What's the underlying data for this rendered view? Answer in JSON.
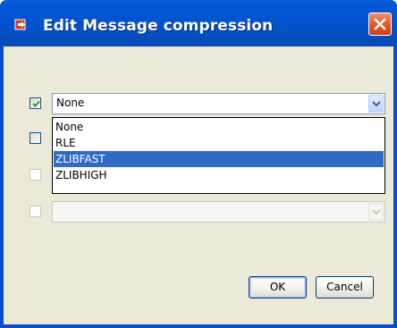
{
  "window": {
    "title": "Edit Message compression"
  },
  "rows": [
    {
      "checked": true,
      "enabled": true,
      "value": "None"
    },
    {
      "checked": false,
      "enabled": true,
      "value": ""
    },
    {
      "checked": false,
      "enabled": false,
      "value": ""
    },
    {
      "checked": false,
      "enabled": false,
      "value": ""
    }
  ],
  "dropdown": {
    "options": [
      "None",
      "RLE",
      "ZLIBFAST",
      "ZLIBHIGH"
    ],
    "highlighted": "ZLIBFAST"
  },
  "buttons": {
    "ok_label": "OK",
    "cancel_label": "Cancel"
  },
  "colors": {
    "title_bar": "#0256d6",
    "client_bg": "#ece9d8",
    "selection": "#316ac5",
    "close_button": "#e0562a"
  },
  "icons": {
    "title": "app-icon",
    "close": "close-icon",
    "combo_arrow": "chevron-down-icon",
    "check": "checkmark-icon"
  }
}
